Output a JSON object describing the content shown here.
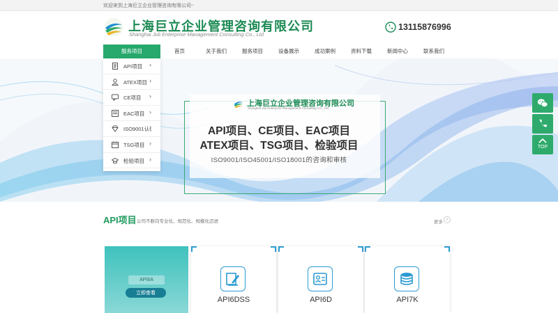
{
  "topbar": {
    "welcome": "欢迎来到上海巨立企业管理咨询有限公司~"
  },
  "brand": {
    "name_cn": "上海巨立企业管理咨询有限公司",
    "name_en": "Shanghai Juli Enterprise Management Consulting Co., Ltd",
    "primary_color": "#1c8a54",
    "accent_color": "#27a86c"
  },
  "phone": {
    "icon": "phone-icon",
    "number": "13115876996"
  },
  "nav": {
    "items": [
      "服务项目",
      "首页",
      "关于我们",
      "服务项目",
      "设备展示",
      "成功案例",
      "资料下载",
      "新闻中心",
      "联系我们"
    ]
  },
  "dropdown": {
    "items": [
      {
        "label": "API项目",
        "icon": "document-icon"
      },
      {
        "label": "ATEX项目",
        "icon": "user-icon"
      },
      {
        "label": "CE项目",
        "icon": "chat-icon"
      },
      {
        "label": "EAC项目",
        "icon": "chart-icon"
      },
      {
        "label": "ISO9001认证",
        "icon": "diamond-icon"
      },
      {
        "label": "TSG项目",
        "icon": "calendar-icon"
      },
      {
        "label": "检验项目",
        "icon": "hat-icon"
      }
    ]
  },
  "banner": {
    "logo_cn": "上海巨立企业管理咨询有限公司",
    "logo_en": "Shanghai Juli Enterprise Management Consulting Co., Ltd",
    "line1": "API项目、CE项目、EAC项目",
    "line2": "ATEX项目、TSG项目、检验项目",
    "line3": "ISO9001/ISO45001/ISO18001的咨询和审核"
  },
  "float_buttons": {
    "wechat_icon": "wechat-icon",
    "phone_icon": "phone-icon",
    "top_label": "TOP"
  },
  "section": {
    "title": "API项目",
    "subtitle": "公司不断向专业化、规范化、规模化迈进",
    "more": "更多"
  },
  "featured_card": {
    "label": "API6A",
    "button": "立即查看"
  },
  "cards": [
    {
      "label": "API6DSS",
      "icon": "pen-document-icon"
    },
    {
      "label": "API6D",
      "icon": "id-card-icon"
    },
    {
      "label": "API7K",
      "icon": "coin-stack-icon"
    }
  ]
}
